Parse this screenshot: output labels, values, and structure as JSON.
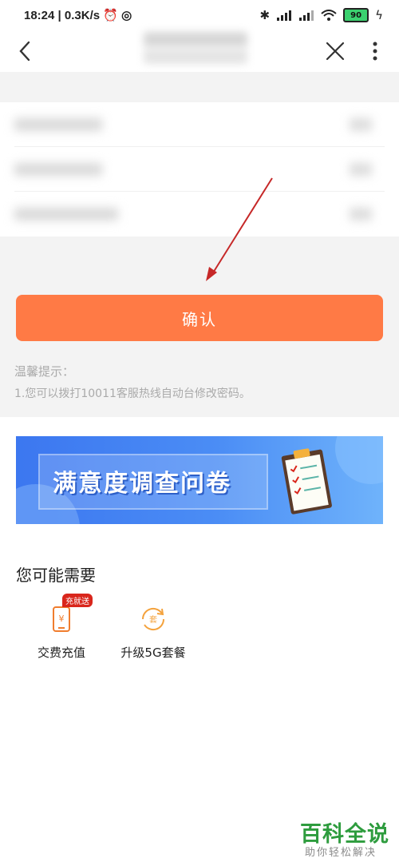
{
  "status_bar": {
    "time": "18:24",
    "speed": "0.3K/s",
    "battery": "90"
  },
  "nav": {
    "back_icon": "chevron-left-icon",
    "close_icon": "close-icon",
    "more_icon": "more-vertical-icon"
  },
  "confirm_button": "确认",
  "tips": {
    "title": "温馨提示：",
    "line1": "1.您可以拨打10011客服热线自动台修改密码。"
  },
  "banner": {
    "text": "满意度调查问卷"
  },
  "section_title": "您可能需要",
  "services": [
    {
      "label": "交费充值",
      "badge": "充就送",
      "icon": "phone-recharge-icon"
    },
    {
      "label": "升级5G套餐",
      "icon_text": "套",
      "icon": "package-upgrade-icon"
    }
  ],
  "watermark": {
    "title": "百科全说",
    "subtitle": "助你轻松解决"
  },
  "colors": {
    "accent": "#ff7a45",
    "badge": "#d9261c",
    "watermark": "#2e9c3e",
    "annotation_arrow": "#c62828"
  }
}
